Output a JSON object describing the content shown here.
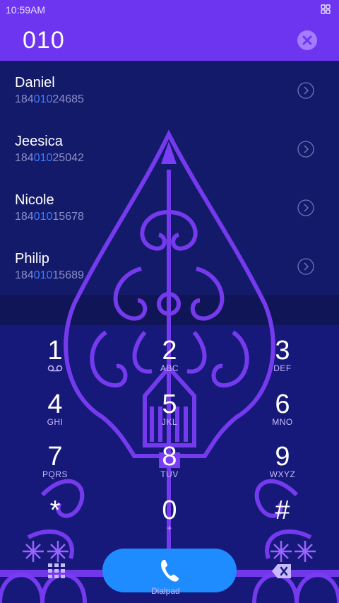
{
  "status_bar": {
    "time": "10:59AM"
  },
  "search": {
    "query": "010"
  },
  "contacts": [
    {
      "name": "Daniel",
      "number_prefix": "184",
      "number_match": "010",
      "number_suffix": "24685"
    },
    {
      "name": "Jeesica",
      "number_prefix": "184",
      "number_match": "010",
      "number_suffix": "25042"
    },
    {
      "name": "Nicole",
      "number_prefix": "184",
      "number_match": "010",
      "number_suffix": "15678"
    },
    {
      "name": "Philip",
      "number_prefix": "184",
      "number_match": "010",
      "number_suffix": "15689"
    }
  ],
  "keypad": [
    {
      "digit": "1",
      "letters": ""
    },
    {
      "digit": "2",
      "letters": "ABC"
    },
    {
      "digit": "3",
      "letters": "DEF"
    },
    {
      "digit": "4",
      "letters": "GHI"
    },
    {
      "digit": "5",
      "letters": "JKL"
    },
    {
      "digit": "6",
      "letters": "MNO"
    },
    {
      "digit": "7",
      "letters": "PQRS"
    },
    {
      "digit": "8",
      "letters": "TUV"
    },
    {
      "digit": "9",
      "letters": "WXYZ"
    },
    {
      "digit": "*",
      "letters": ""
    },
    {
      "digit": "0",
      "letters": "+"
    },
    {
      "digit": "#",
      "letters": ""
    }
  ],
  "bottom": {
    "dialpad_label": "Dialpad"
  },
  "colors": {
    "accent": "#6d35f0",
    "list_bg": "#141a6a",
    "call": "#1e8cff",
    "match": "#3b7dff"
  },
  "icons": [
    "grid-icon",
    "clear-icon",
    "chevron-right-icon",
    "voicemail-icon",
    "phone-icon",
    "dialpad-icon",
    "backspace-icon"
  ]
}
